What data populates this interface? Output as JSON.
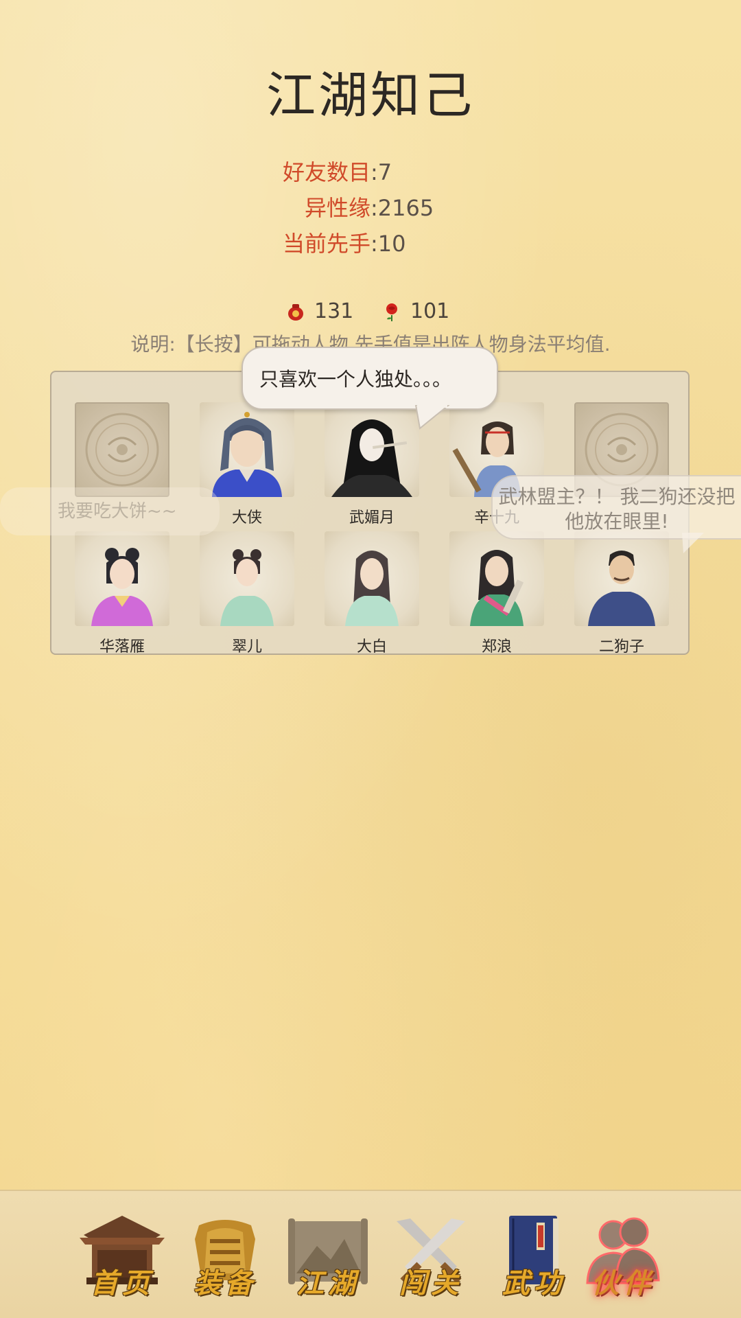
{
  "page": {
    "title": "江湖知己"
  },
  "stats": [
    {
      "label": "好友数目",
      "value": ":7"
    },
    {
      "label": "异性缘",
      "value": ":2165"
    },
    {
      "label": "当前先手",
      "value": ":10"
    }
  ],
  "currency": {
    "wine": {
      "icon": "wine-jar-icon",
      "value": "131"
    },
    "rose": {
      "icon": "rose-icon",
      "value": "101"
    }
  },
  "instructions": "说明:【长按】可拖动人物.先手值是出阵人物身法平均值.",
  "speech": {
    "main": "只喜欢一个人独处。。。",
    "left_faded": "我要吃大饼~~",
    "right_faded_line1": "武林盟主？！ 我二狗还没把",
    "right_faded_line2": "他放在眼里!"
  },
  "party": {
    "row1": [
      {
        "name": "",
        "empty": true
      },
      {
        "name": "大侠"
      },
      {
        "name": "武媚月"
      },
      {
        "name": "辛十九"
      },
      {
        "name": "",
        "empty": true
      }
    ],
    "row2": [
      {
        "name": "华落雁"
      },
      {
        "name": "翠儿"
      },
      {
        "name": "大白"
      },
      {
        "name": "郑浪"
      },
      {
        "name": "二狗子"
      }
    ]
  },
  "nav": [
    {
      "label": "首页",
      "icon": "house-icon"
    },
    {
      "label": "装备",
      "icon": "armor-icon"
    },
    {
      "label": "江湖",
      "icon": "map-scroll-icon"
    },
    {
      "label": "闯关",
      "icon": "crossed-swords-icon"
    },
    {
      "label": "武功",
      "icon": "martial-book-icon"
    },
    {
      "label": "伙伴",
      "icon": "partners-icon",
      "active": true
    }
  ],
  "colors": {
    "stat_label": "#d04a2a",
    "background": "#f5dd9c",
    "nav_text": "#e6a92a"
  }
}
